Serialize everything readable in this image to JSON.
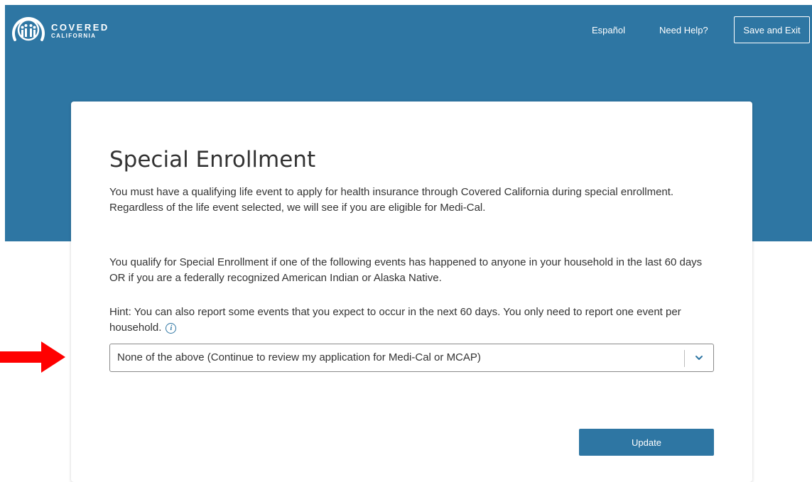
{
  "header": {
    "brand": {
      "line1": "COVERED",
      "line2": "CALIFORNIA"
    },
    "nav": {
      "espanol": "Español",
      "help": "Need Help?"
    },
    "save_exit_label": "Save and Exit"
  },
  "main": {
    "title": "Special Enrollment",
    "intro": "You must have a qualifying life event to apply for health insurance through Covered California during special enrollment. Regardless of the life event selected, we will see if you are eligible for Medi-Cal.",
    "qualify": "You qualify for Special Enrollment if one of the following events has happened to anyone in your household in the last 60 days OR if you are a federally recognized American Indian or Alaska Native.",
    "hint": "Hint: You can also report some events that you expect to occur in the next 60 days. You only need to report one event per household.",
    "info_icon": "info-icon",
    "event_select": {
      "value": "None of the above (Continue to review my application for Medi-Cal or MCAP)"
    },
    "update_label": "Update"
  },
  "annotation": {
    "arrow_icon": "right-arrow-icon",
    "color": "#ff0000"
  },
  "colors": {
    "brand_blue": "#2e76a3",
    "background": "#ffffff",
    "text": "#333333"
  }
}
